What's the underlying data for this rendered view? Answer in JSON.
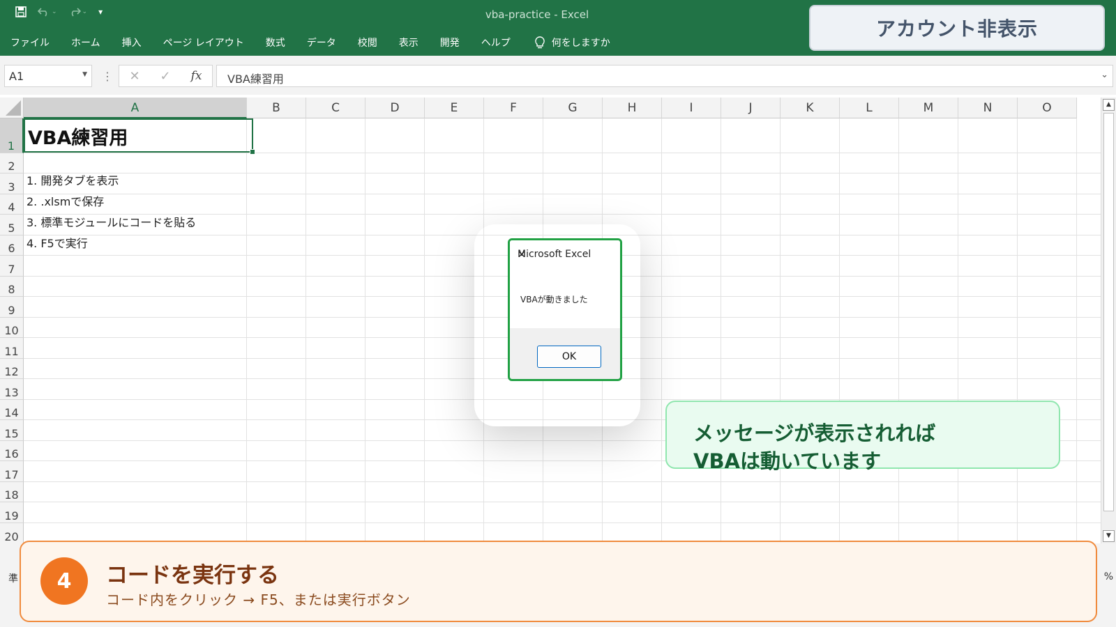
{
  "window": {
    "title": "vba-practice  -  Excel"
  },
  "qat": {
    "undo_caret": "⌄",
    "redo_caret": "⌄",
    "customize": "▾"
  },
  "ribbon": {
    "tabs": [
      "ファイル",
      "ホーム",
      "挿入",
      "ページ レイアウト",
      "数式",
      "データ",
      "校閲",
      "表示",
      "開発",
      "ヘルプ"
    ],
    "tell_me": "何をしますか"
  },
  "account_overlay": "アカウント非表示",
  "formula_bar": {
    "name_box": "A1",
    "formula": "VBA練習用",
    "fx": "fx",
    "cancel": "✕",
    "enter": "✓"
  },
  "sheet": {
    "columns": [
      "A",
      "B",
      "C",
      "D",
      "E",
      "F",
      "G",
      "H",
      "I",
      "J",
      "K",
      "L",
      "M",
      "N",
      "O"
    ],
    "rows": [
      "1",
      "2",
      "3",
      "4",
      "5",
      "6",
      "7",
      "8",
      "9",
      "10",
      "11",
      "12",
      "13",
      "14",
      "15",
      "16",
      "17",
      "18",
      "19",
      "20"
    ],
    "selected_column": "A",
    "selected_row": "1",
    "cells": {
      "A1": "VBA練習用",
      "A3": "1. 開発タブを表示",
      "A4": "2. .xlsmで保存",
      "A5": "3. 標準モジュールにコードを貼る",
      "A6": "4. F5で実行"
    }
  },
  "status": {
    "left": "準",
    "right": "%"
  },
  "message_box": {
    "title": "Microsoft Excel",
    "message": "VBAが動きました",
    "ok_label": "OK",
    "close": "✕"
  },
  "callout": {
    "line1": "メッセージが表示されれば",
    "line2": "VBAは動いています"
  },
  "step": {
    "number": "4",
    "heading": "コードを実行する",
    "subtext": "コード内をクリック → F5、または実行ボタン"
  }
}
